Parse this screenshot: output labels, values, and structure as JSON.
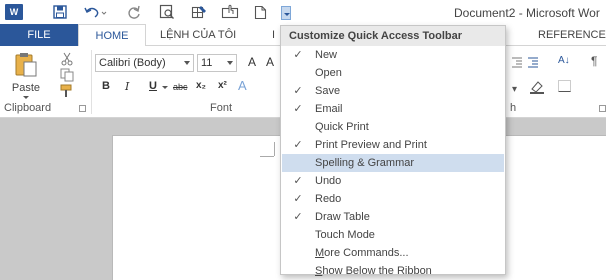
{
  "window": {
    "title": "Document2 - Microsoft Wor",
    "app_logo": "W",
    "qat_icons": [
      "save-icon",
      "undo-icon",
      "redo-icon",
      "print-preview-icon",
      "draw-table-icon",
      "touch-mode-icon",
      "new-document-icon",
      "customize-qat-dropdown-icon"
    ]
  },
  "tabs": {
    "file": "FILE",
    "home": "HOME",
    "lenh": "LỆNH CỦA TÔI",
    "insert_partial": "I",
    "references": "REFERENCES"
  },
  "ribbon": {
    "paste_label": "Paste",
    "clipboard_label": "Clipboard",
    "font_label": "Font",
    "paragraph_label_partial": "h",
    "font_name": "Calibri (Body)",
    "font_size": "11",
    "grow_font": "A",
    "grow_font_partial": "A",
    "bold": "B",
    "italic": "I",
    "underline": "U",
    "strikethrough": "abc",
    "subscript": "x₂",
    "superscript": "x²",
    "text_effects": "A",
    "sort_icon": "A↓",
    "pilcrow": "¶"
  },
  "menu": {
    "header": "Customize Quick Access Toolbar",
    "items": [
      {
        "label": "New",
        "checked": true
      },
      {
        "label": "Open",
        "checked": false
      },
      {
        "label": "Save",
        "checked": true
      },
      {
        "label": "Email",
        "checked": true
      },
      {
        "label": "Quick Print",
        "checked": false
      },
      {
        "label": "Print Preview and Print",
        "checked": true
      },
      {
        "label": "Spelling & Grammar",
        "checked": false,
        "highlighted": true
      },
      {
        "label": "Undo",
        "checked": true
      },
      {
        "label": "Redo",
        "checked": true
      },
      {
        "label": "Draw Table",
        "checked": true
      },
      {
        "label": "Touch Mode",
        "checked": false
      },
      {
        "label": "More Commands...",
        "checked": false
      },
      {
        "label": "Show Below the Ribbon",
        "checked": false
      }
    ],
    "check_glyph": "✓"
  },
  "colors": {
    "accent": "#2b579a",
    "highlight": "#cfddee",
    "header_bg": "#e9e9e9"
  }
}
